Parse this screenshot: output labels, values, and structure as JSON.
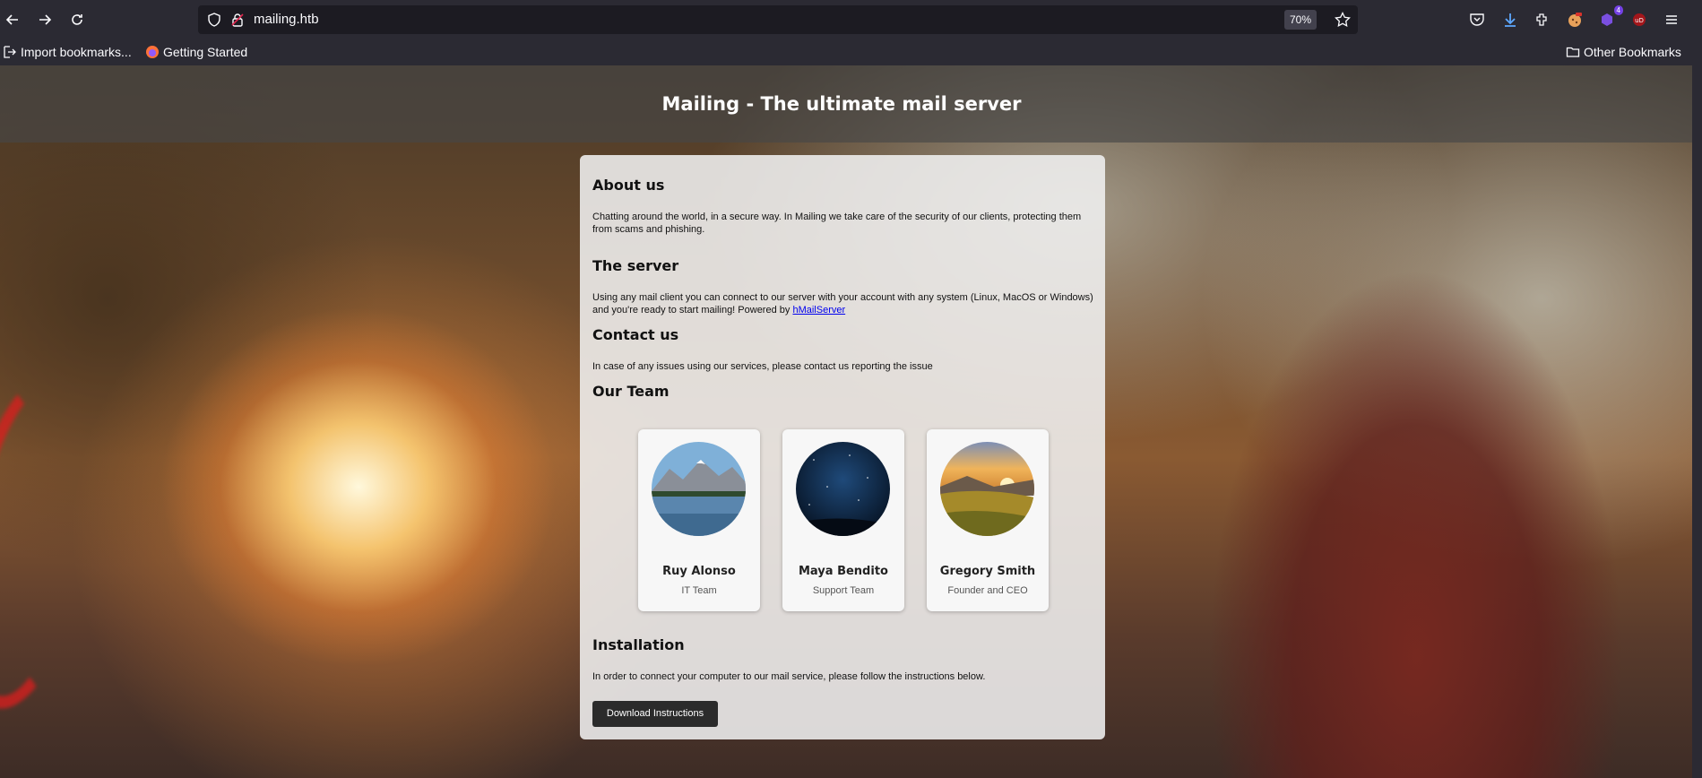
{
  "browser": {
    "url": "mailing.htb",
    "zoom": "70%",
    "toolbar_icons": [
      "back-icon",
      "forward-icon",
      "reload-icon",
      "shield-icon",
      "lock-icon",
      "star-icon",
      "pocket-icon",
      "download-icon",
      "extensions-icon",
      "container-extension-icon",
      "ublock-icon",
      "menu-icon"
    ],
    "extension_badge": "4",
    "bookmarks": {
      "import": "Import bookmarks...",
      "getting_started": "Getting Started",
      "other": "Other Bookmarks"
    }
  },
  "page": {
    "title": "Mailing - The ultimate mail server",
    "about": {
      "heading": "About us",
      "text": "Chatting around the world, in a secure way. In Mailing we take care of the security of our clients, protecting them from scams and phishing."
    },
    "server": {
      "heading": "The server",
      "text": "Using any mail client you can connect to our server with your account with any system (Linux, MacOS or Windows) and you're ready to start mailing! Powered by",
      "link": "hMailServer"
    },
    "contact": {
      "heading": "Contact us",
      "text": "In case of any issues using our services, please contact us reporting the issue"
    },
    "team": {
      "heading": "Our Team",
      "members": [
        {
          "name": "Ruy Alonso",
          "role": "IT Team"
        },
        {
          "name": "Maya Bendito",
          "role": "Support Team"
        },
        {
          "name": "Gregory Smith",
          "role": "Founder and CEO"
        }
      ]
    },
    "installation": {
      "heading": "Installation",
      "text": "In order to connect your computer to our mail service, please follow the instructions below.",
      "button": "Download Instructions"
    }
  }
}
